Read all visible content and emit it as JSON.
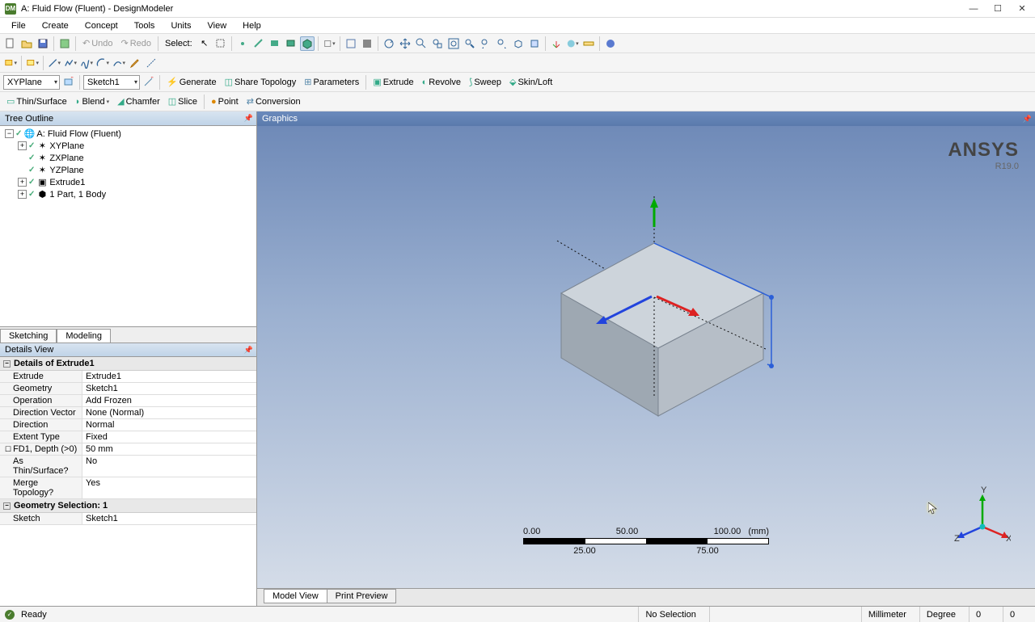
{
  "title": "A: Fluid Flow (Fluent) - DesignModeler",
  "menu": {
    "file": "File",
    "create": "Create",
    "concept": "Concept",
    "tools": "Tools",
    "units": "Units",
    "view": "View",
    "help": "Help"
  },
  "toolbar1": {
    "undo": "Undo",
    "redo": "Redo",
    "select": "Select:"
  },
  "toolbar3": {
    "plane": "XYPlane",
    "sketch": "Sketch1",
    "generate": "Generate",
    "share_topology": "Share Topology",
    "parameters": "Parameters",
    "extrude": "Extrude",
    "revolve": "Revolve",
    "sweep": "Sweep",
    "skinloft": "Skin/Loft"
  },
  "toolbar4": {
    "thin_surface": "Thin/Surface",
    "blend": "Blend",
    "chamfer": "Chamfer",
    "slice": "Slice",
    "point": "Point",
    "conversion": "Conversion"
  },
  "tree": {
    "header": "Tree Outline",
    "root": "A: Fluid Flow (Fluent)",
    "xyplane": "XYPlane",
    "zxplane": "ZXPlane",
    "yzplane": "YZPlane",
    "extrude1": "Extrude1",
    "part": "1 Part, 1 Body"
  },
  "mode_tabs": {
    "sketching": "Sketching",
    "modeling": "Modeling"
  },
  "details": {
    "header": "Details View",
    "group1": "Details of Extrude1",
    "extrude_k": "Extrude",
    "extrude_v": "Extrude1",
    "geometry_k": "Geometry",
    "geometry_v": "Sketch1",
    "operation_k": "Operation",
    "operation_v": "Add Frozen",
    "dirvec_k": "Direction Vector",
    "dirvec_v": "None (Normal)",
    "direction_k": "Direction",
    "direction_v": "Normal",
    "extent_k": "Extent Type",
    "extent_v": "Fixed",
    "depth_k": "FD1, Depth (>0)",
    "depth_v": "50 mm",
    "thin_k": "As Thin/Surface?",
    "thin_v": "No",
    "merge_k": "Merge Topology?",
    "merge_v": "Yes",
    "group2": "Geometry Selection: 1",
    "sketch_k": "Sketch",
    "sketch_v": "Sketch1"
  },
  "graphics": {
    "header": "Graphics",
    "brand": "ANSYS",
    "version": "R19.0",
    "scale": {
      "t0": "0.00",
      "t50": "50.00",
      "t100": "100.00",
      "unit": "(mm)",
      "t25": "25.00",
      "t75": "75.00"
    },
    "triad": {
      "x": "X",
      "y": "Y",
      "z": "Z"
    }
  },
  "bottom_tabs": {
    "model": "Model View",
    "print": "Print Preview"
  },
  "status": {
    "ready": "Ready",
    "sel": "No Selection",
    "unit_len": "Millimeter",
    "unit_ang": "Degree",
    "v1": "0",
    "v2": "0"
  }
}
